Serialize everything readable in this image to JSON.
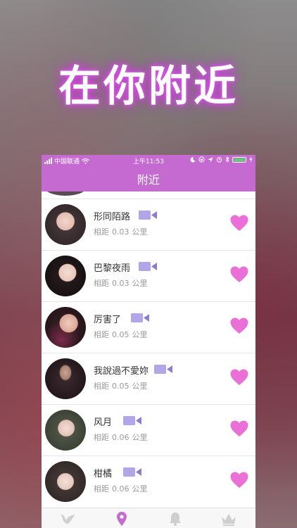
{
  "promo": {
    "headline": "在你附近"
  },
  "status_bar": {
    "carrier": "中国联通",
    "time": "上午11:53"
  },
  "nav": {
    "title": "附近"
  },
  "distance_label": "相距",
  "distance_unit": "公里",
  "users": [
    {
      "name": "形同陌路",
      "distance": "0.03"
    },
    {
      "name": "巴黎夜雨",
      "distance": "0.03"
    },
    {
      "name": "厉害了",
      "distance": "0.05"
    },
    {
      "name": "我說過不愛妳",
      "distance": "0.05"
    },
    {
      "name": "风月",
      "distance": "0.06"
    },
    {
      "name": "柑橘",
      "distance": "0.06"
    }
  ],
  "tabs": [
    {
      "icon": "bird-icon",
      "active": false
    },
    {
      "icon": "location-pin-icon",
      "active": true
    },
    {
      "icon": "bell-icon",
      "active": false
    },
    {
      "icon": "crown-icon",
      "active": false
    }
  ],
  "colors": {
    "accent": "#c56ad1",
    "heart": "#e96bd3",
    "video_icon": "#a28fdc",
    "battery": "#4cd964"
  }
}
